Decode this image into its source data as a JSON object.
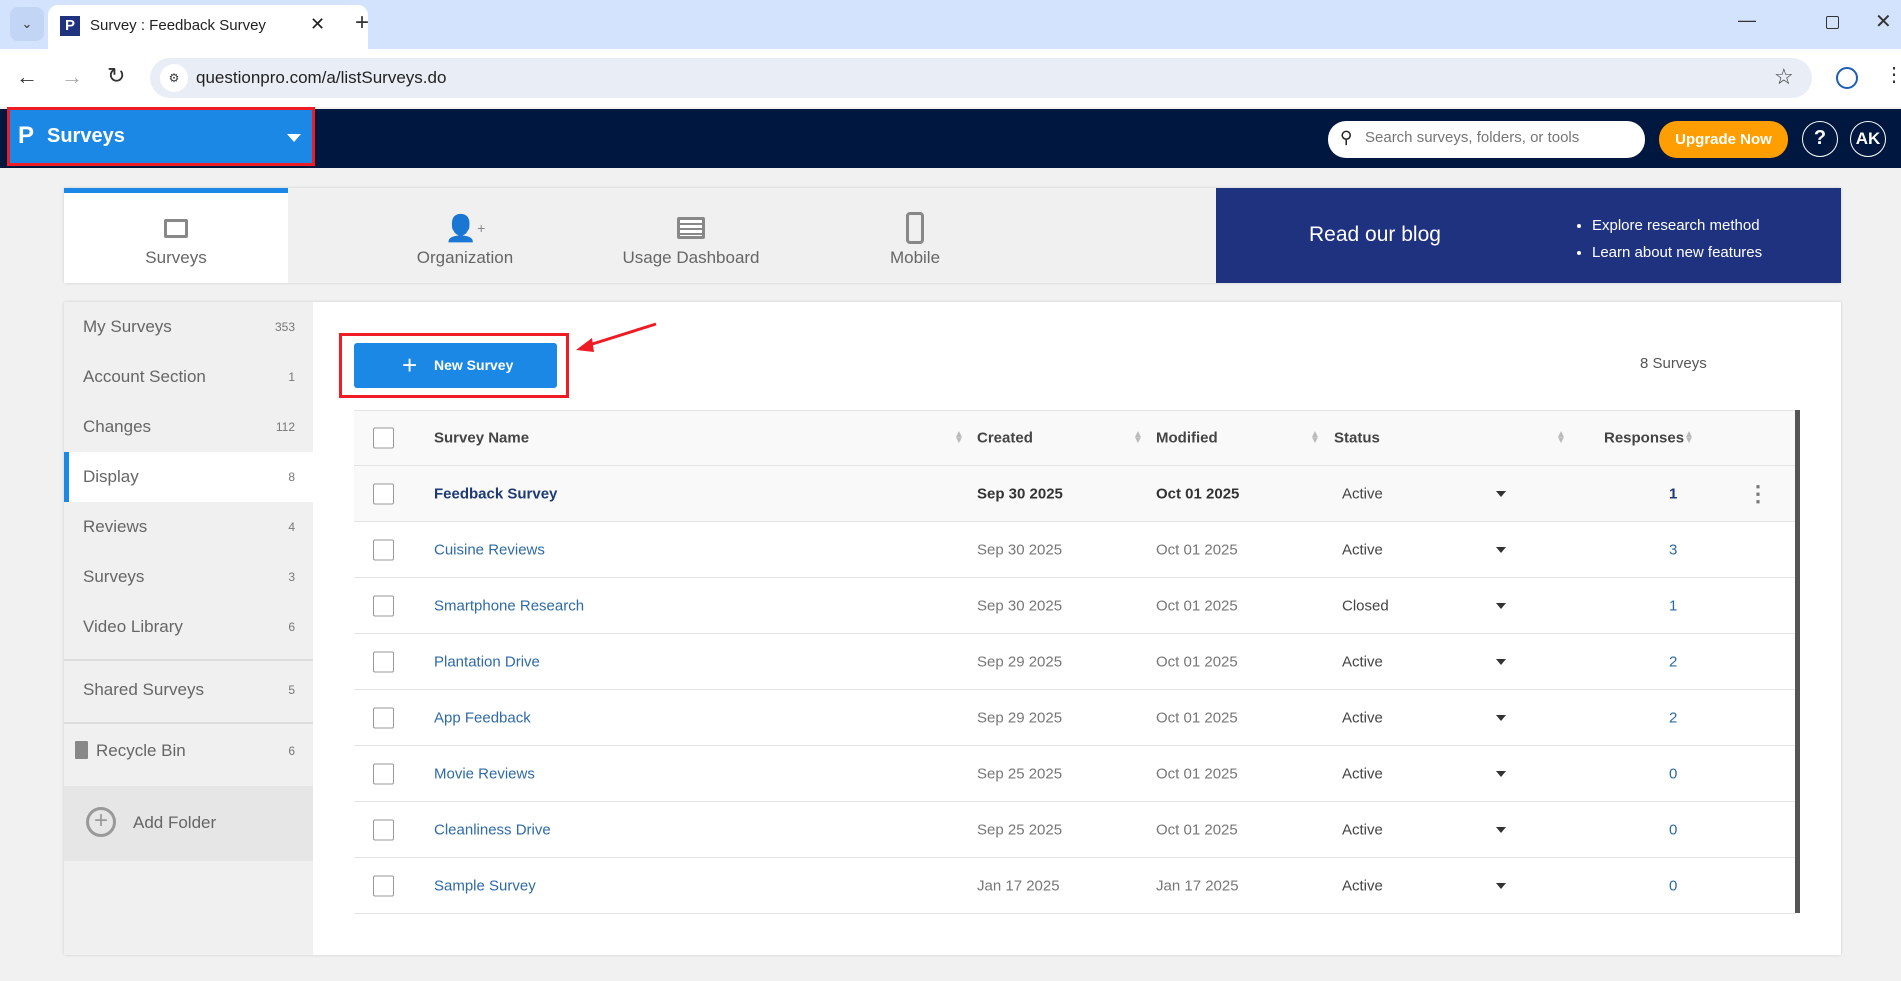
{
  "browser": {
    "tab_title": "Survey : Feedback Survey",
    "url": "questionpro.com/a/listSurveys.do"
  },
  "header": {
    "product": "Surveys",
    "search_placeholder": "Search surveys, folders, or tools",
    "upgrade": "Upgrade Now",
    "help": "?",
    "avatar": "AK"
  },
  "nav_tabs": [
    {
      "label": "Surveys",
      "icon": "folder-icon"
    },
    {
      "label": "Organization",
      "icon": "user-plus-icon"
    },
    {
      "label": "Usage Dashboard",
      "icon": "dashboard-icon"
    },
    {
      "label": "Mobile",
      "icon": "mobile-icon"
    }
  ],
  "blog": {
    "title": "Read our blog",
    "bullets": [
      "Explore research method",
      "Learn about new features"
    ]
  },
  "sidebar": {
    "folders": [
      {
        "label": "My Surveys",
        "count": "353"
      },
      {
        "label": "Account Section",
        "count": "1"
      },
      {
        "label": "Changes",
        "count": "112"
      },
      {
        "label": "Display",
        "count": "8"
      },
      {
        "label": "Reviews",
        "count": "4"
      },
      {
        "label": "Surveys",
        "count": "3"
      },
      {
        "label": "Video Library",
        "count": "6"
      }
    ],
    "shared": {
      "label": "Shared Surveys",
      "count": "5"
    },
    "recycle": {
      "label": "Recycle Bin",
      "count": "6"
    },
    "add_folder": "Add Folder"
  },
  "main": {
    "new_survey": "New Survey",
    "count_label": "8 Surveys",
    "columns": [
      "Survey Name",
      "Created",
      "Modified",
      "Status",
      "Responses"
    ],
    "rows": [
      {
        "name": "Feedback Survey",
        "created": "Sep 30 2025",
        "modified": "Oct 01 2025",
        "status": "Active",
        "responses": "1"
      },
      {
        "name": "Cuisine Reviews",
        "created": "Sep 30 2025",
        "modified": "Oct 01 2025",
        "status": "Active",
        "responses": "3"
      },
      {
        "name": "Smartphone Research",
        "created": "Sep 30 2025",
        "modified": "Oct 01 2025",
        "status": "Closed",
        "responses": "1"
      },
      {
        "name": "Plantation Drive",
        "created": "Sep 29 2025",
        "modified": "Oct 01 2025",
        "status": "Active",
        "responses": "2"
      },
      {
        "name": "App Feedback",
        "created": "Sep 29 2025",
        "modified": "Oct 01 2025",
        "status": "Active",
        "responses": "2"
      },
      {
        "name": "Movie Reviews",
        "created": "Sep 25 2025",
        "modified": "Oct 01 2025",
        "status": "Active",
        "responses": "0"
      },
      {
        "name": "Cleanliness Drive",
        "created": "Sep 25 2025",
        "modified": "Oct 01 2025",
        "status": "Active",
        "responses": "0"
      },
      {
        "name": "Sample Survey",
        "created": "Jan 17 2025",
        "modified": "Jan 17 2025",
        "status": "Active",
        "responses": "0"
      }
    ]
  },
  "colors": {
    "brand_blue": "#1b88e5",
    "header_navy": "#001740",
    "blog_blue": "#1e3280",
    "upgrade_orange": "#ff9e00",
    "highlight_red": "#ee1c24"
  }
}
